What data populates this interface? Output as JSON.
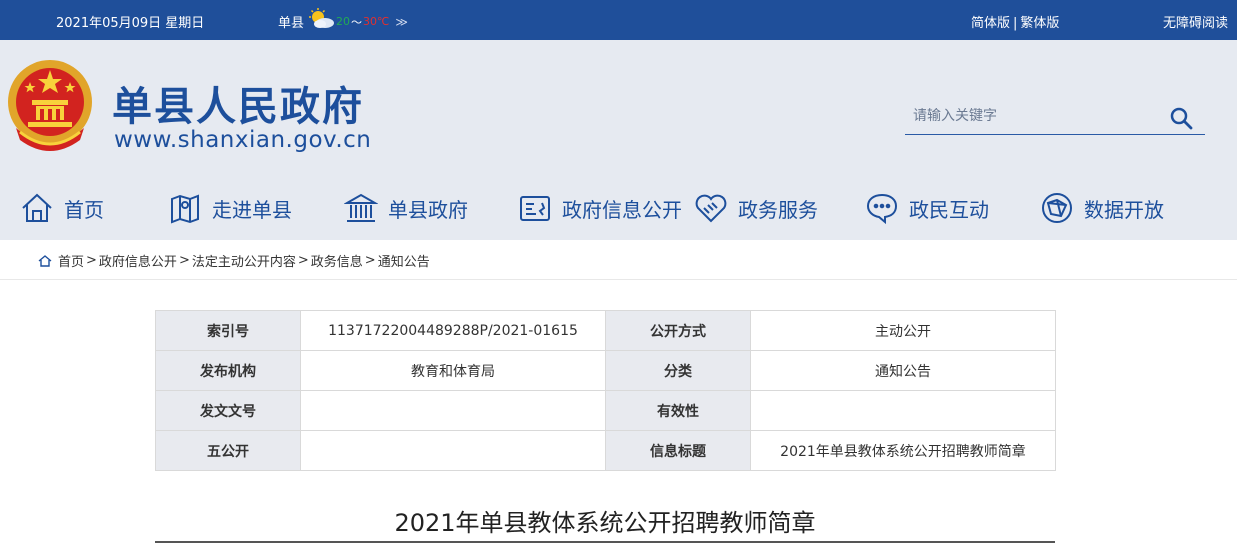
{
  "topbar": {
    "date": "2021年05月09日 星期日",
    "weather": {
      "city": "单县",
      "low": "20",
      "tilde": "～",
      "high": "30℃",
      "more": "≫"
    },
    "lang_simplified": "简体版",
    "lang_sep": "|",
    "lang_traditional": "繁体版",
    "accessibility": "无障碍阅读"
  },
  "header": {
    "site_name": "单县人民政府",
    "site_url": "www.shanxian.gov.cn",
    "search_placeholder": "请输入关键字"
  },
  "nav": [
    {
      "label": "首页",
      "icon": "home-icon"
    },
    {
      "label": "走进单县",
      "icon": "map-icon"
    },
    {
      "label": "单县政府",
      "icon": "government-building-icon"
    },
    {
      "label": "政府信息公开",
      "icon": "info-card-icon"
    },
    {
      "label": "政务服务",
      "icon": "handshake-icon"
    },
    {
      "label": "政民互动",
      "icon": "chat-icon"
    },
    {
      "label": "数据开放",
      "icon": "data-network-icon"
    }
  ],
  "breadcrumb": [
    "首页",
    "政府信息公开",
    "法定主动公开内容",
    "政务信息",
    "通知公告"
  ],
  "breadcrumb_sep": ">",
  "meta": {
    "rows": [
      [
        "索引号",
        "11371722004489288P/2021-01615",
        "公开方式",
        "主动公开"
      ],
      [
        "发布机构",
        "教育和体育局",
        "分类",
        "通知公告"
      ],
      [
        "发文文号",
        "",
        "有效性",
        ""
      ],
      [
        "五公开",
        "",
        "信息标题",
        "2021年单县教体系统公开招聘教师简章"
      ]
    ]
  },
  "article": {
    "title": "2021年单县教体系统公开招聘教师简章"
  },
  "colors": {
    "brand_blue": "#1f4f9a",
    "header_bg": "#e6eaf1",
    "table_key_bg": "#e8eaef"
  }
}
